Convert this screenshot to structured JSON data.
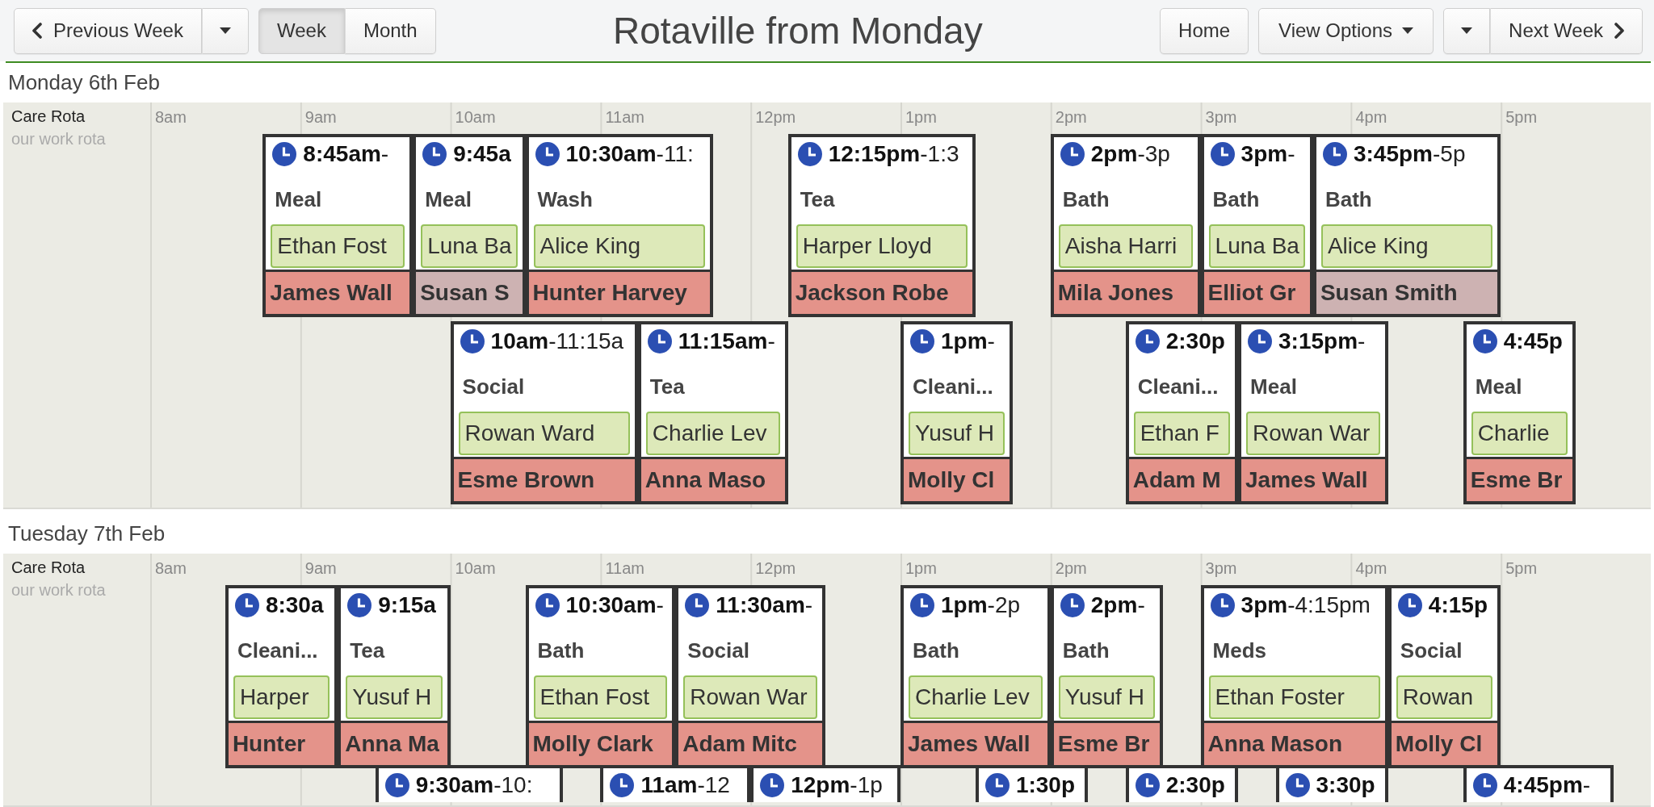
{
  "toolbar": {
    "previous_button": "Previous Week",
    "view_tabs": [
      {
        "label": "Week",
        "selected": true
      },
      {
        "label": "Month",
        "selected": false
      }
    ],
    "title": "Rotaville from Monday",
    "home_button": "Home",
    "view_options_button": "View Options",
    "next_button": "Next Week"
  },
  "days": [
    {
      "date": "Monday 6th Feb",
      "rota": {
        "name": "Care Rota",
        "description": "our work rota"
      },
      "hours": [
        "8am",
        "9am",
        "10am",
        "11am",
        "12pm",
        "1pm",
        "2pm",
        "3pm",
        "4pm",
        "5pm"
      ],
      "lanes": [
        {
          "shifts": [
            {
              "start": "8:45am",
              "end": "-",
              "activity": "Meal",
              "carer": "Ethan Fost",
              "client": {
                "name": "James Wall",
                "color": "#e4938a"
              }
            },
            {
              "start": "9:45a",
              "activity": "Meal",
              "carer": "Luna Ba",
              "client": {
                "name": "Susan S",
                "color": "#cdb2b2"
              }
            },
            {
              "start": "10:30am",
              "end": "-11:",
              "activity": "Wash",
              "carer": "Alice King",
              "client": {
                "name": "Hunter Harvey",
                "color": "#e4938a"
              }
            },
            {
              "start": "12:15pm",
              "end": "-1:3",
              "activity": "Tea",
              "carer": "Harper Lloyd",
              "client": {
                "name": "Jackson Robe",
                "color": "#e4938a"
              }
            },
            {
              "start": "2pm",
              "end": "-3p",
              "activity": "Bath",
              "carer": "Aisha Harri",
              "client": {
                "name": "Mila Jones",
                "color": "#e4938a"
              }
            },
            {
              "start": "3pm",
              "end": "-",
              "activity": "Bath",
              "carer": "Luna Ba",
              "client": {
                "name": "Elliot Gr",
                "color": "#e4938a"
              }
            },
            {
              "start": "3:45pm",
              "end": "-5p",
              "activity": "Bath",
              "carer": "Alice King",
              "client": {
                "name": "Susan Smith",
                "color": "#cdb2b2"
              }
            }
          ]
        },
        {
          "shifts": [
            {
              "start": "10am",
              "end": "-11:15a",
              "activity": "Social",
              "carer": "Rowan Ward",
              "client": {
                "name": "Esme Brown",
                "color": "#e4938a"
              }
            },
            {
              "start": "11:15am",
              "end": "-",
              "activity": "Tea",
              "carer": "Charlie Lev",
              "client": {
                "name": "Anna Maso",
                "color": "#e4938a"
              }
            },
            {
              "start": "1pm",
              "end": "-",
              "activity": "Cleani...",
              "carer": "Yusuf H",
              "client": {
                "name": "Molly Cl",
                "color": "#e4938a"
              }
            },
            {
              "start": "2:30p",
              "activity": "Cleani...",
              "carer": "Ethan F",
              "client": {
                "name": "Adam M",
                "color": "#e4938a"
              }
            },
            {
              "start": "3:15pm",
              "end": "-",
              "activity": "Meal",
              "carer": "Rowan War",
              "client": {
                "name": "James Wall",
                "color": "#e4938a"
              }
            },
            {
              "start": "4:45p",
              "activity": "Meal",
              "carer": "Charlie",
              "client": {
                "name": "Esme Br",
                "color": "#e4938a"
              }
            }
          ]
        }
      ]
    },
    {
      "date": "Tuesday 7th Feb",
      "rota": {
        "name": "Care Rota",
        "description": "our work rota"
      },
      "hours": [
        "8am",
        "9am",
        "10am",
        "11am",
        "12pm",
        "1pm",
        "2pm",
        "3pm",
        "4pm",
        "5pm"
      ],
      "lanes": [
        {
          "shifts": [
            {
              "start": "8:30a",
              "activity": "Cleani...",
              "carer": "Harper",
              "client": {
                "name": "Hunter",
                "color": "#e4938a"
              }
            },
            {
              "start": "9:15a",
              "activity": "Tea",
              "carer": "Yusuf H",
              "client": {
                "name": "Anna Ma",
                "color": "#e4938a"
              }
            },
            {
              "start": "10:30am",
              "end": "-",
              "activity": "Bath",
              "carer": "Ethan Fost",
              "client": {
                "name": "Molly Clark",
                "color": "#e4938a"
              }
            },
            {
              "start": "11:30am",
              "end": "-",
              "activity": "Social",
              "carer": "Rowan War",
              "client": {
                "name": "Adam Mitc",
                "color": "#e4938a"
              }
            },
            {
              "start": "1pm",
              "end": "-2p",
              "activity": "Bath",
              "carer": "Charlie Lev",
              "client": {
                "name": "James Wall",
                "color": "#e4938a"
              }
            },
            {
              "start": "2pm",
              "end": "-",
              "activity": "Bath",
              "carer": "Yusuf H",
              "client": {
                "name": "Esme Br",
                "color": "#e4938a"
              }
            },
            {
              "start": "3pm",
              "end": "-4:15pm",
              "activity": "Meds",
              "carer": "Ethan Foster",
              "client": {
                "name": "Anna Mason",
                "color": "#e4938a"
              }
            },
            {
              "start": "4:15p",
              "activity": "Social",
              "carer": "Rowan",
              "client": {
                "name": "Molly Cl",
                "color": "#e4938a"
              }
            }
          ]
        },
        {
          "shifts": [
            {
              "start": "9:30am",
              "end": "-10:"
            },
            {
              "start": "11am",
              "end": "-12"
            },
            {
              "start": "12pm",
              "end": "-1p"
            },
            {
              "start": "1:30p"
            },
            {
              "start": "2:30p"
            },
            {
              "start": "3:30p"
            },
            {
              "start": "4:45pm",
              "end": "-"
            }
          ]
        }
      ]
    }
  ]
}
